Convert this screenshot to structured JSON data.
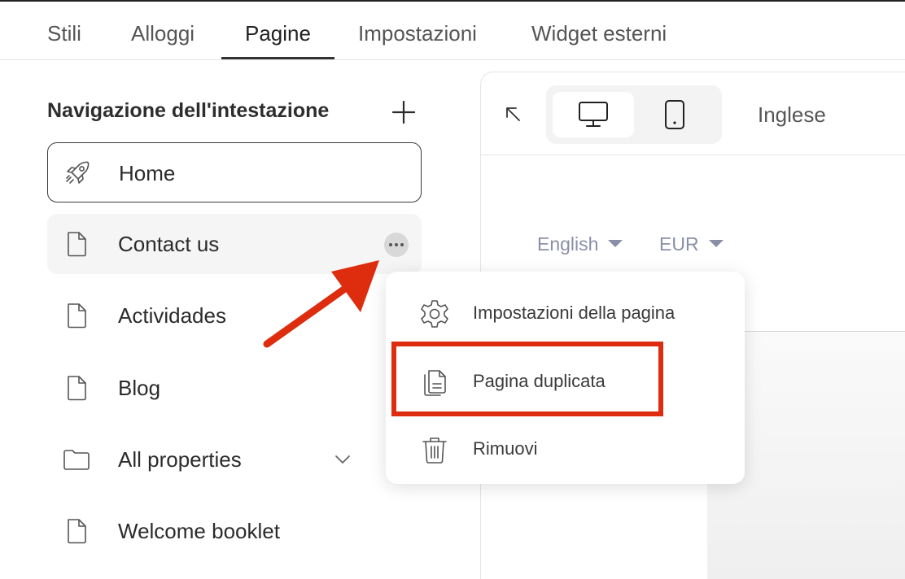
{
  "tabs": [
    {
      "label": "Stili"
    },
    {
      "label": "Alloggi"
    },
    {
      "label": "Pagine"
    },
    {
      "label": "Impostazioni"
    },
    {
      "label": "Widget esterni"
    }
  ],
  "active_tab": "Pagine",
  "sidebar": {
    "title": "Navigazione dell'intestazione",
    "add_icon": "plus-icon",
    "items": [
      {
        "label": "Home",
        "icon": "rocket-icon",
        "state": "selected"
      },
      {
        "label": "Contact us",
        "icon": "page-icon",
        "state": "hovered"
      },
      {
        "label": "Actividades",
        "icon": "page-icon"
      },
      {
        "label": "Blog",
        "icon": "page-icon"
      },
      {
        "label": "All properties",
        "icon": "folder-icon",
        "expandable": true
      },
      {
        "label": "Welcome booklet",
        "icon": "page-icon"
      }
    ]
  },
  "preview": {
    "collapse_icon": "arrow-up-left-icon",
    "devices": [
      {
        "name": "desktop",
        "icon": "monitor-icon",
        "active": true
      },
      {
        "name": "mobile",
        "icon": "phone-icon",
        "active": false
      }
    ],
    "language": "Inglese",
    "site_language": "English",
    "site_currency": "EUR"
  },
  "context_menu": {
    "items": [
      {
        "label": "Impostazioni della pagina",
        "icon": "gear-icon"
      },
      {
        "label": "Pagina duplicata",
        "icon": "duplicate-icon",
        "highlighted": true
      },
      {
        "label": "Rimuovi",
        "icon": "trash-icon"
      }
    ]
  },
  "colors": {
    "annotation": "#dd2c0e",
    "accent": "#333333",
    "muted_text": "#8a8fa8"
  }
}
